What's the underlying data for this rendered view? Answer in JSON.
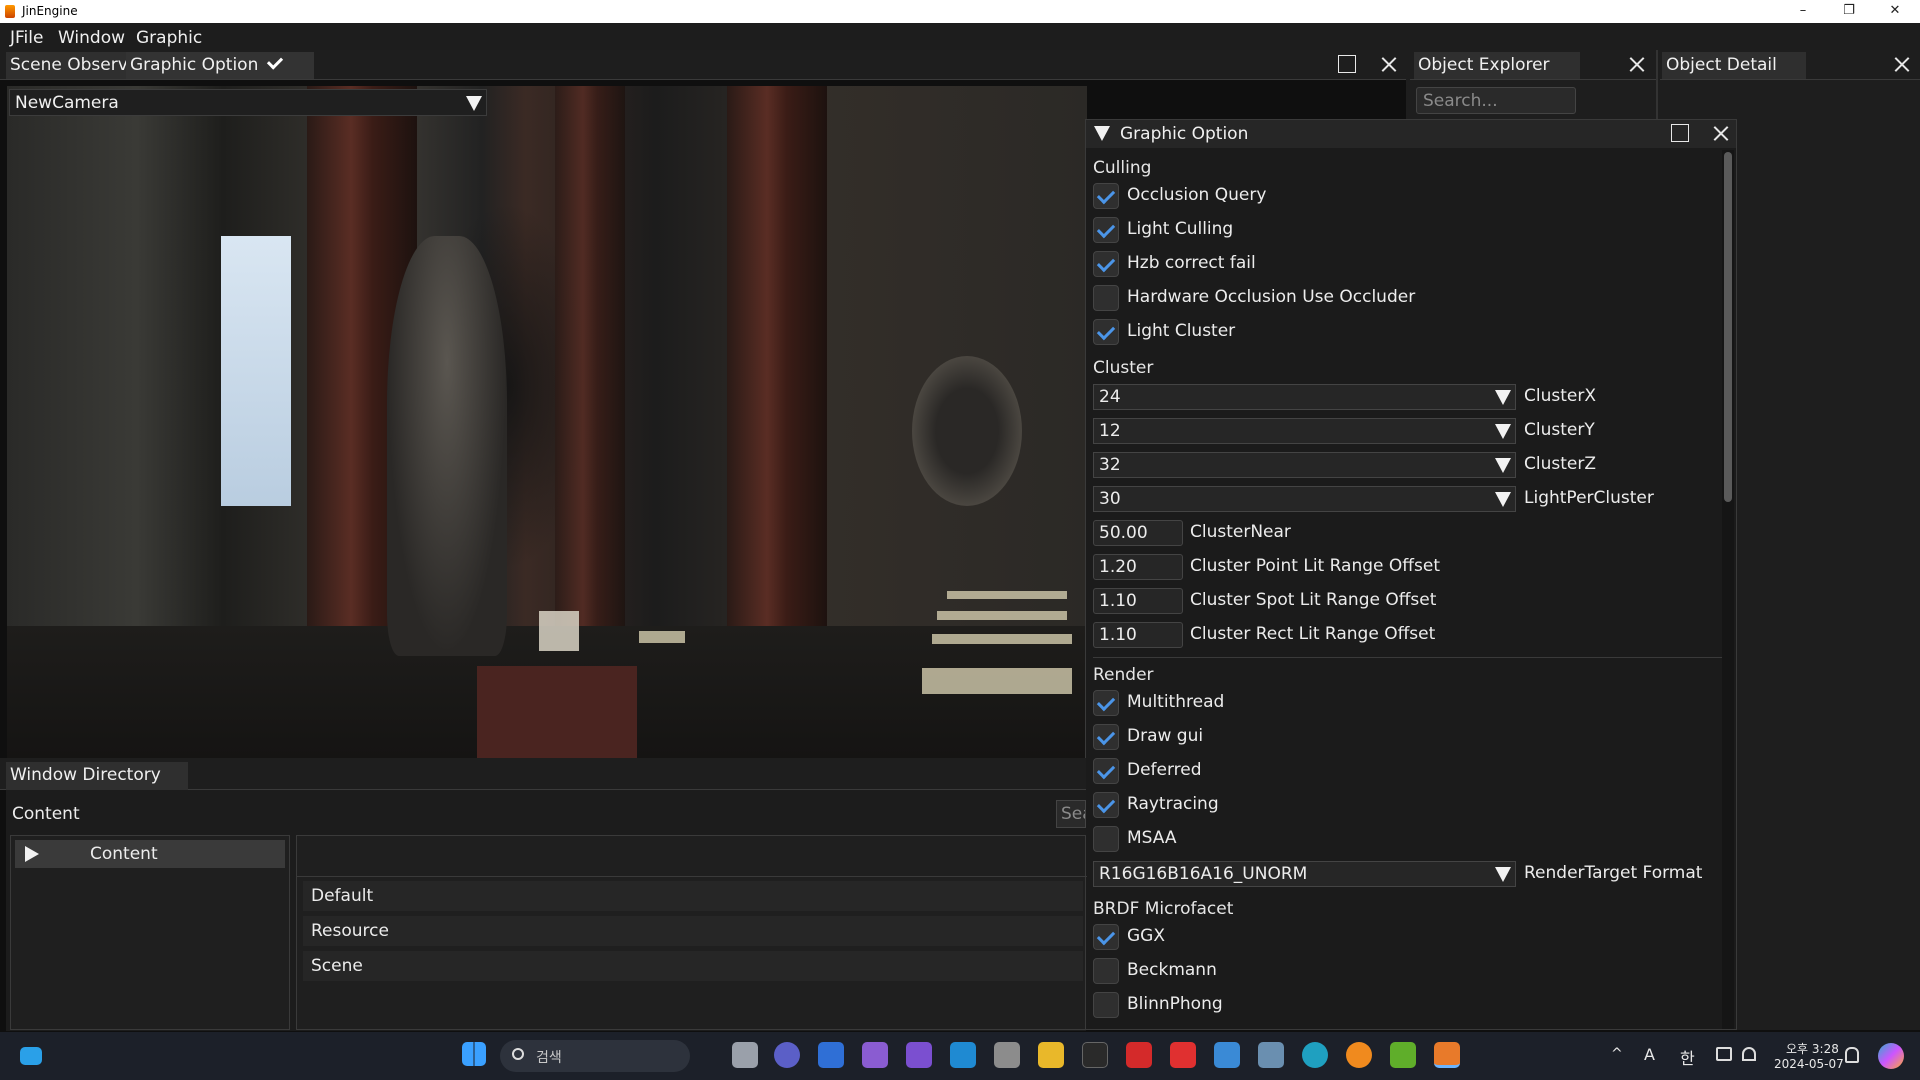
{
  "window": {
    "title": "JinEngine",
    "min": "–",
    "max": "❐",
    "close": "✕"
  },
  "menu": [
    "JFile",
    "Window",
    "Graphic"
  ],
  "scene_tabs": {
    "scene_observer": "Scene Observe",
    "graphic_option": "Graphic Option"
  },
  "camera": {
    "selected": "NewCamera"
  },
  "object_explorer": {
    "tab": "Object Explorer",
    "search_placeholder": "Search..."
  },
  "object_detail": {
    "tab": "Object Detail"
  },
  "graphic_option": {
    "title": "Graphic Option",
    "culling": {
      "label": "Culling",
      "items": [
        {
          "label": "Occlusion Query",
          "checked": true
        },
        {
          "label": "Light Culling",
          "checked": true
        },
        {
          "label": "Hzb correct fail",
          "checked": true
        },
        {
          "label": "Hardware Occlusion Use Occluder",
          "checked": false
        },
        {
          "label": "Light Cluster",
          "checked": true
        }
      ]
    },
    "cluster": {
      "label": "Cluster",
      "combos": [
        {
          "value": "24",
          "label": "ClusterX"
        },
        {
          "value": "12",
          "label": "ClusterY"
        },
        {
          "value": "32",
          "label": "ClusterZ"
        },
        {
          "value": "30",
          "label": "LightPerCluster"
        }
      ],
      "numbers": [
        {
          "value": "50.00",
          "label": "ClusterNear"
        },
        {
          "value": "1.20",
          "label": "Cluster Point Lit Range Offset"
        },
        {
          "value": "1.10",
          "label": "Cluster Spot Lit Range Offset"
        },
        {
          "value": "1.10",
          "label": "Cluster Rect Lit Range Offset"
        }
      ]
    },
    "render": {
      "label": "Render",
      "items": [
        {
          "label": "Multithread",
          "checked": true
        },
        {
          "label": "Draw gui",
          "checked": true
        },
        {
          "label": "Deferred",
          "checked": true
        },
        {
          "label": "Raytracing",
          "checked": true
        },
        {
          "label": "MSAA",
          "checked": false
        }
      ],
      "format": {
        "value": "R16G16B16A16_UNORM",
        "label": "RenderTarget Format"
      }
    },
    "brdf": {
      "label": "BRDF Microfacet",
      "items": [
        {
          "label": "GGX",
          "checked": true
        },
        {
          "label": "Beckmann",
          "checked": false
        },
        {
          "label": "BlinnPhong",
          "checked": false
        }
      ]
    }
  },
  "window_directory": {
    "tab": "Window Directory",
    "header": "Content",
    "search_placeholder": "Sea",
    "tree": [
      "Content"
    ],
    "folders": [
      "Default",
      "Resource",
      "Scene"
    ]
  },
  "taskbar": {
    "search": "검색",
    "ime_a": "A",
    "ime_han": "한",
    "time": "오후 3:28",
    "date": "2024-05-07"
  },
  "colors": {
    "accent": "#4b95e8",
    "panel": "#1b1b1b",
    "taskbar": "#1c2029"
  }
}
